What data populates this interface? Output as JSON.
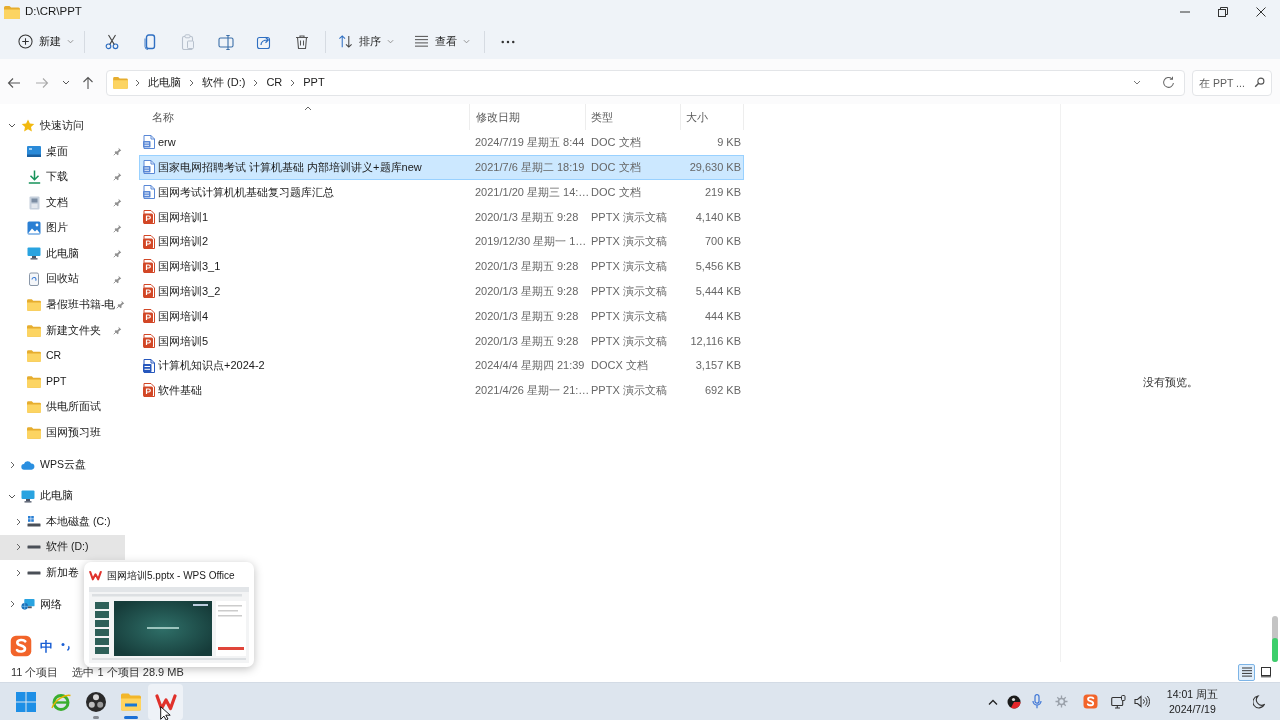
{
  "window": {
    "title": "D:\\CR\\PPT"
  },
  "command_bar": {
    "new_menu": {
      "label": "新建"
    },
    "actions": [
      {
        "kind": "cut",
        "disabled": false
      },
      {
        "kind": "copy",
        "disabled": false
      },
      {
        "kind": "paste",
        "disabled": true
      },
      {
        "kind": "rename",
        "disabled": false
      },
      {
        "kind": "share",
        "disabled": false
      },
      {
        "kind": "delete",
        "disabled": false
      }
    ],
    "sort_menu": {
      "label": "排序"
    },
    "view_menu": {
      "label": "查看"
    }
  },
  "navigation": {
    "buttons": [
      {
        "kind": "back",
        "disabled": false
      },
      {
        "kind": "forward",
        "disabled": true
      },
      {
        "kind": "recent",
        "disabled": false
      },
      {
        "kind": "up",
        "disabled": false
      }
    ]
  },
  "address_bar": {
    "breadcrumbs": [
      "此电脑",
      "软件 (D:)",
      "CR",
      "PPT"
    ]
  },
  "search": {
    "placeholder": "在 PPT ..."
  },
  "sidebar": {
    "items": [
      {
        "kind": "quick_access",
        "label": "快速访问",
        "expanded": true,
        "selected": false,
        "children": [
          {
            "kind": "desktop",
            "label": "桌面",
            "pinned": true,
            "selected": false
          },
          {
            "kind": "downloads",
            "label": "下载",
            "pinned": true,
            "selected": false
          },
          {
            "kind": "documents",
            "label": "文档",
            "pinned": true,
            "selected": false
          },
          {
            "kind": "pictures",
            "label": "图片",
            "pinned": true,
            "selected": false
          },
          {
            "kind": "computer",
            "label": "此电脑",
            "pinned": true,
            "selected": false
          },
          {
            "kind": "recycle_bin",
            "label": "回收站",
            "pinned": true,
            "selected": false
          },
          {
            "kind": "folder",
            "label": "暑假班书籍-电",
            "pinned": true,
            "selected": false
          },
          {
            "kind": "folder",
            "label": "新建文件夹",
            "pinned": true,
            "selected": false
          },
          {
            "kind": "folder",
            "label": "CR",
            "pinned": false,
            "selected": false
          },
          {
            "kind": "folder",
            "label": "PPT",
            "pinned": false,
            "selected": false
          },
          {
            "kind": "folder",
            "label": "供电所面试",
            "pinned": false,
            "selected": false
          },
          {
            "kind": "folder",
            "label": "国网预习班",
            "pinned": false,
            "selected": false
          }
        ]
      },
      {
        "kind": "cloud",
        "label": "WPS云盘",
        "expanded": false,
        "selected": false
      },
      {
        "kind": "computer",
        "label": "此电脑",
        "expanded": true,
        "selected": false,
        "children": [
          {
            "kind": "system_drive",
            "label": "本地磁盘 (C:)",
            "expanded": false,
            "selected": false
          },
          {
            "kind": "drive",
            "label": "软件 (D:)",
            "expanded": false,
            "selected": true
          },
          {
            "kind": "drive",
            "label": "新加卷",
            "expanded": false,
            "selected": false
          }
        ]
      },
      {
        "kind": "network",
        "label": "网络",
        "expanded": false,
        "selected": false
      }
    ]
  },
  "file_list": {
    "columns": [
      {
        "label": "名称",
        "sorted": true
      },
      {
        "label": "修改日期",
        "sorted": false
      },
      {
        "label": "类型",
        "sorted": false
      },
      {
        "label": "大小",
        "sorted": false
      }
    ],
    "rows": [
      {
        "kind": "doc",
        "name": "erw",
        "modified": "2024/7/19 星期五 8:44",
        "type": "DOC 文档",
        "size": "9 KB",
        "selected": false
      },
      {
        "kind": "doc",
        "name": "国家电网招聘考试 计算机基础 内部培训讲义+题库new",
        "modified": "2021/7/6 星期二 18:19",
        "type": "DOC 文档",
        "size": "29,630 KB",
        "selected": true
      },
      {
        "kind": "doc",
        "name": "国网考试计算机机基础复习题库汇总",
        "modified": "2021/1/20 星期三 14:…",
        "type": "DOC 文档",
        "size": "219 KB",
        "selected": false
      },
      {
        "kind": "pptx",
        "name": "国网培训1",
        "modified": "2020/1/3 星期五 9:28",
        "type": "PPTX 演示文稿",
        "size": "4,140 KB",
        "selected": false
      },
      {
        "kind": "pptx",
        "name": "国网培训2",
        "modified": "2019/12/30 星期一 1…",
        "type": "PPTX 演示文稿",
        "size": "700 KB",
        "selected": false
      },
      {
        "kind": "pptx",
        "name": "国网培训3_1",
        "modified": "2020/1/3 星期五 9:28",
        "type": "PPTX 演示文稿",
        "size": "5,456 KB",
        "selected": false
      },
      {
        "kind": "pptx",
        "name": "国网培训3_2",
        "modified": "2020/1/3 星期五 9:28",
        "type": "PPTX 演示文稿",
        "size": "5,444 KB",
        "selected": false
      },
      {
        "kind": "pptx",
        "name": "国网培训4",
        "modified": "2020/1/3 星期五 9:28",
        "type": "PPTX 演示文稿",
        "size": "444 KB",
        "selected": false
      },
      {
        "kind": "pptx",
        "name": "国网培训5",
        "modified": "2020/1/3 星期五 9:28",
        "type": "PPTX 演示文稿",
        "size": "12,116 KB",
        "selected": false
      },
      {
        "kind": "docx",
        "name": "计算机知识点+2024-2",
        "modified": "2024/4/4 星期四 21:39",
        "type": "DOCX 文档",
        "size": "3,157 KB",
        "selected": false
      },
      {
        "kind": "pptx",
        "name": "软件基础",
        "modified": "2021/4/26 星期一 21:…",
        "type": "PPTX 演示文稿",
        "size": "692 KB",
        "selected": false
      }
    ]
  },
  "preview": {
    "message": "没有预览。"
  },
  "status_bar": {
    "item_count": "11 个项目",
    "selection": "选中 1 个项目 28.9 MB",
    "views": [
      {
        "kind": "details",
        "selected": true
      },
      {
        "kind": "tiles",
        "selected": false
      }
    ]
  },
  "ime_bar": {
    "mode": "中"
  },
  "thumbnail_popup": {
    "title": "国网培训5.pptx - WPS Office"
  },
  "taskbar": {
    "apps": [
      {
        "kind": "start",
        "running": false,
        "active": false,
        "hovered": false
      },
      {
        "kind": "browser",
        "running": false,
        "active": false,
        "hovered": false
      },
      {
        "kind": "recorder",
        "running": true,
        "active": false,
        "hovered": false
      },
      {
        "kind": "file_explorer",
        "running": true,
        "active": true,
        "hovered": false
      },
      {
        "kind": "wps_office",
        "running": false,
        "active": false,
        "hovered": true
      }
    ],
    "clock": {
      "time": "14:01 周五",
      "date": "2024/7/19"
    }
  }
}
